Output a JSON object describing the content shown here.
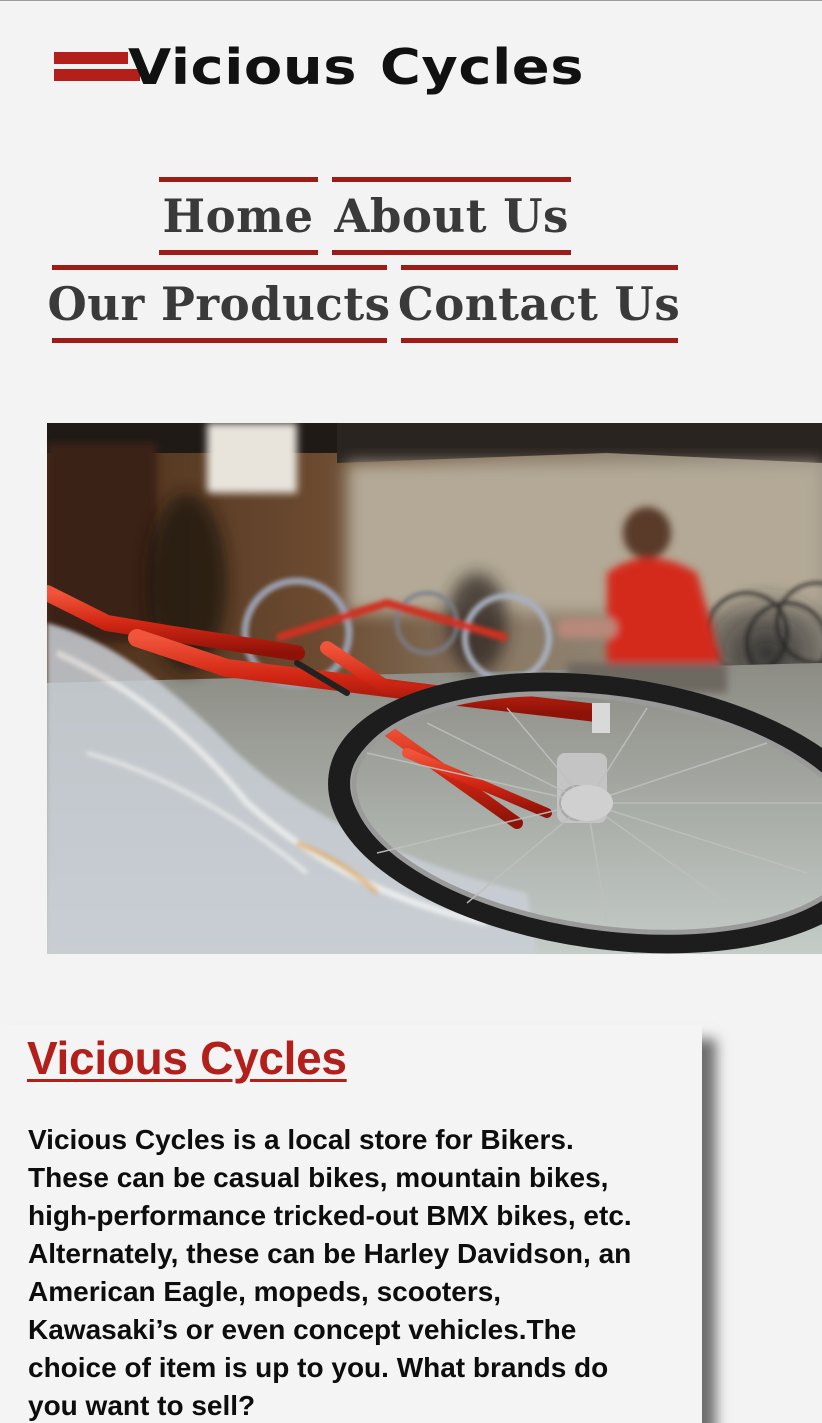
{
  "brand": {
    "name_word1": "Vicious",
    "name_word2": "Cycles",
    "accent_color": "#b31f1a",
    "nav_border_color": "#9e1c18"
  },
  "nav": {
    "home": "Home",
    "about": "About Us",
    "products": "Our Products",
    "contact": "Contact Us"
  },
  "hero": {
    "icon": "bicycle-workshop-photo"
  },
  "content": {
    "title": "Vicious Cycles",
    "body": "Vicious Cycles is a local store for Bikers. These can be casual bikes, mountain bikes, high-performance tricked-out BMX bikes, etc. Alternately, these can be Harley Davidson, an American Eagle, mopeds, scooters, Kawasaki’s or even concept vehicles.The choice of item is up to you. What brands do you want to sell?"
  }
}
